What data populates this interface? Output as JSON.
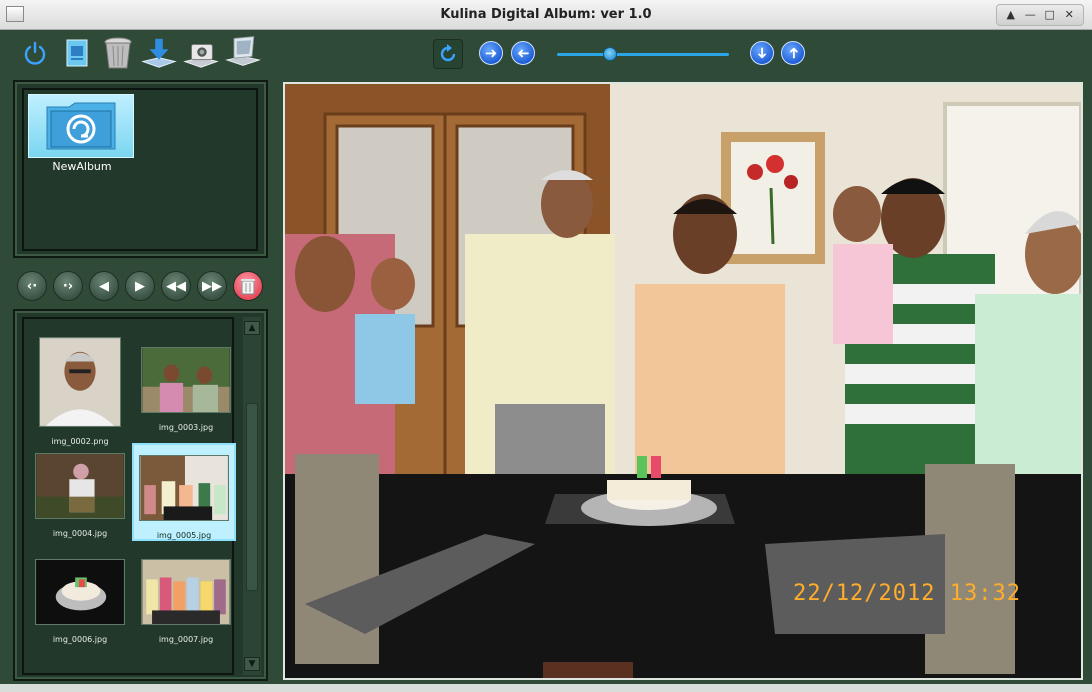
{
  "window": {
    "title": "Kulina Digital Album: ver 1.0",
    "controls": [
      "up-arrow",
      "minimize",
      "maximize",
      "close"
    ]
  },
  "toolbar": {
    "icons": [
      "power-icon",
      "album-icon",
      "trash-icon",
      "download-icon",
      "camera-icon",
      "laptop-icon"
    ],
    "nav_icons": [
      "rotate-icon",
      "next-arrow-icon",
      "previous-arrow-icon",
      "down-arrow-icon",
      "up-arrow-icon"
    ],
    "zoom_fraction": 0.31
  },
  "albums": [
    {
      "label": "NewAlbum"
    }
  ],
  "controls": {
    "buttons": [
      "first",
      "last",
      "previous",
      "play",
      "rewind",
      "fast-forward",
      "delete"
    ]
  },
  "thumbnails": [
    {
      "caption": "img_0002.png",
      "selected": false
    },
    {
      "caption": "img_0003.jpg",
      "selected": false
    },
    {
      "caption": "img_0004.jpg",
      "selected": false
    },
    {
      "caption": "img_0005.jpg",
      "selected": true
    },
    {
      "caption": "img_0006.jpg",
      "selected": false
    },
    {
      "caption": "img_0007.jpg",
      "selected": false
    }
  ],
  "photo": {
    "timestamp": "22/12/2012  13:32"
  },
  "colors": {
    "background": "#2f4a36",
    "panel": "#22382a",
    "selection": "#bff0ff",
    "timestamp": "#ffae2c",
    "accent_blue": "#1f5fd6"
  }
}
